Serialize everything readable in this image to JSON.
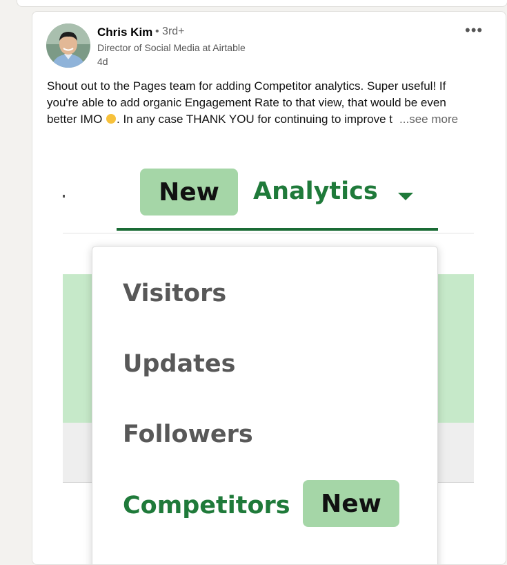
{
  "author": {
    "name": "Chris Kim",
    "degree": "• 3rd+",
    "title": "Director of Social Media at Airtable",
    "time": "4d"
  },
  "post": {
    "line1": "Shout out to the Pages team for adding Competitor analytics. Super useful! If",
    "line2": "you're able to add organic Engagement Rate to that view, that would be even",
    "line3_before_emoji": "better IMO ",
    "line3_after_emoji": ". In any case THANK YOU for continuing to improve t",
    "see_more": "...see more"
  },
  "menu_button": "•••",
  "image": {
    "new_badge": "New",
    "analytics_label": "Analytics",
    "menu_items": [
      "Visitors",
      "Updates",
      "Followers",
      "Competitors"
    ],
    "competitors_badge": "New"
  },
  "colors": {
    "accent_green": "#1f7a3a",
    "badge_green": "#a5d6a7",
    "band_green": "#c6e9c9"
  }
}
